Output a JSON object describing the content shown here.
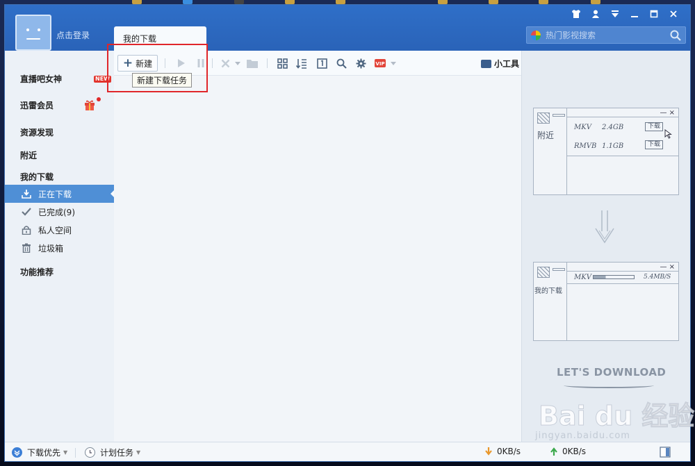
{
  "window": {
    "login_text": "点击登录",
    "active_tab": "我的下载",
    "search_placeholder": "热门影视搜索"
  },
  "sidebar": {
    "items": [
      {
        "label": "直播吧女神",
        "badge": "NEW"
      },
      {
        "label": "迅雷会员"
      },
      {
        "label": "资源发现"
      },
      {
        "label": "附近"
      },
      {
        "label": "我的下载"
      }
    ],
    "downloads": [
      {
        "label": "正在下载",
        "icon": "download-icon",
        "active": true
      },
      {
        "label": "已完成(9)",
        "icon": "check-icon",
        "active": false
      },
      {
        "label": "私人空间",
        "icon": "lock-icon",
        "active": false
      },
      {
        "label": "垃圾箱",
        "icon": "trash-icon",
        "active": false
      }
    ],
    "features": "功能推荐"
  },
  "toolbar": {
    "new_label": "新建",
    "tooltip": "新建下载任务",
    "tools_label": "小工具"
  },
  "illustration": {
    "panel1_title": "附近",
    "panel1_rows": [
      {
        "format": "MKV",
        "size": "2.4GB",
        "action": "下载"
      },
      {
        "format": "RMVB",
        "size": "1.1GB",
        "action": "下载"
      }
    ],
    "panel2_title": "我的下载",
    "panel2_row": {
      "format": "MKV",
      "speed": "5.4MB/S"
    },
    "tagline": "LET'S DOWNLOAD"
  },
  "statusbar": {
    "priority": "下载优先",
    "schedule": "计划任务",
    "download_speed": "0KB/s",
    "upload_speed": "0KB/s"
  },
  "watermark": {
    "main": "Bai du 经验",
    "sub": "jingyan.baidu.com"
  },
  "colors": {
    "titlebar": "#2f6fc8",
    "sidebar_active": "#4f8fd6",
    "highlight_frame": "#e0262a"
  }
}
